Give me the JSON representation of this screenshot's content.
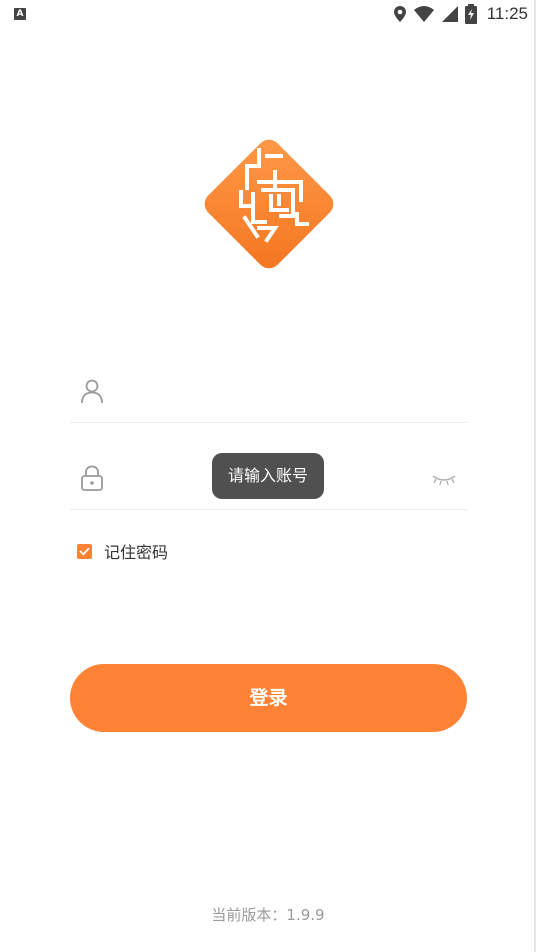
{
  "status_bar": {
    "left_icon": "A",
    "time": "11:25",
    "icons": [
      "location-icon",
      "wifi-icon",
      "signal-icon",
      "battery-icon"
    ]
  },
  "logo": {
    "icon": "app-logo-icon",
    "color": "#ff8235"
  },
  "form": {
    "account": {
      "icon": "user-icon",
      "value": "",
      "placeholder": ""
    },
    "password": {
      "icon": "lock-icon",
      "value": "",
      "placeholder": "",
      "toggle_icon": "eye-closed-icon"
    },
    "remember": {
      "label": "记住密码",
      "checked": true
    },
    "login_label": "登录"
  },
  "toast": {
    "text": "请输入账号"
  },
  "footer": {
    "version_label": "当前版本：",
    "version_value": "1.9.9"
  },
  "colors": {
    "accent": "#ff8235",
    "toast_bg": "#505050",
    "muted_text": "#9a9a9a"
  }
}
